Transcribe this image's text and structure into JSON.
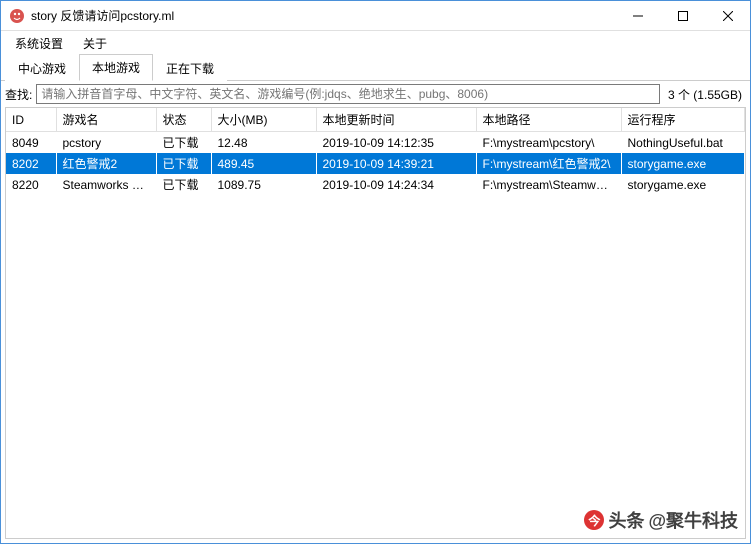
{
  "window": {
    "title": "story 反馈请访问pcstory.ml"
  },
  "menu": {
    "items": [
      "系统设置",
      "关于"
    ]
  },
  "tabs": {
    "items": [
      "中心游戏",
      "本地游戏",
      "正在下载"
    ],
    "activeIndex": 1
  },
  "search": {
    "label": "查找:",
    "placeholder": "请输入拼音首字母、中文字符、英文名、游戏编号(例:jdqs、绝地求生、pubg、8006)",
    "value": ""
  },
  "countLabel": "3 个 (1.55GB)",
  "table": {
    "columns": [
      "ID",
      "游戏名",
      "状态",
      "大小(MB)",
      "本地更新时间",
      "本地路径",
      "运行程序"
    ],
    "rows": [
      {
        "id": "8049",
        "name": "pcstory",
        "status": "已下载",
        "size": "12.48",
        "time": "2019-10-09 14:12:35",
        "path": "F:\\mystream\\pcstory\\",
        "exe": "NothingUseful.bat",
        "selected": false
      },
      {
        "id": "8202",
        "name": "红色警戒2",
        "status": "已下载",
        "size": "489.45",
        "time": "2019-10-09 14:39:21",
        "path": "F:\\mystream\\红色警戒2\\",
        "exe": "storygame.exe",
        "selected": true
      },
      {
        "id": "8220",
        "name": "Steamworks Sh...",
        "status": "已下载",
        "size": "1089.75",
        "time": "2019-10-09 14:24:34",
        "path": "F:\\mystream\\Steamworks S...",
        "exe": "storygame.exe",
        "selected": false
      }
    ]
  },
  "watermark": {
    "prefix": "头条",
    "author": "@聚牛科技"
  }
}
